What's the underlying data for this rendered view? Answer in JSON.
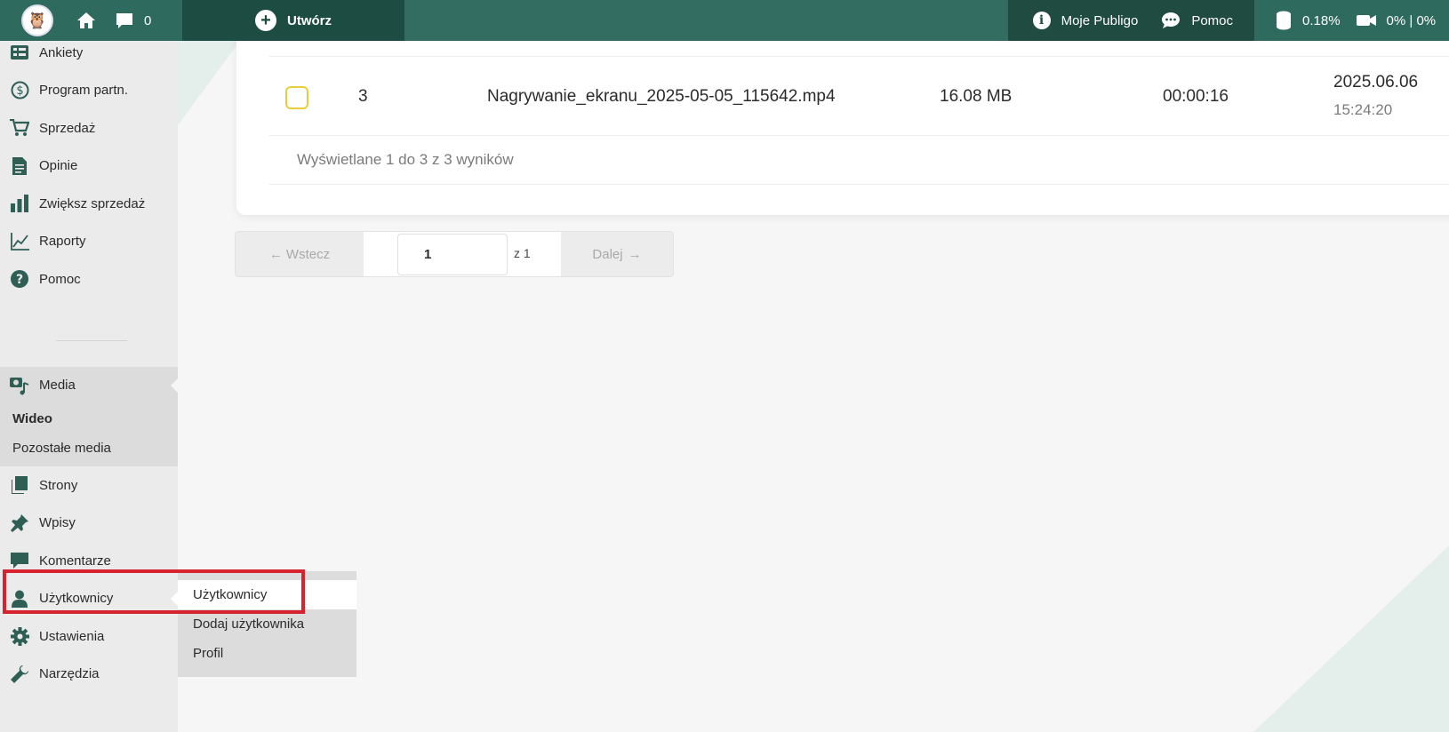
{
  "topbar": {
    "logo_icon": "owl-logo-icon",
    "comments_count": "0",
    "create_label": "Utwórz",
    "my_publigo_label": "Moje Publigo",
    "help_label": "Pomoc",
    "storage_usage": "0.18%",
    "video_usage": "0% | 0%"
  },
  "sidebar": {
    "items_top": [
      {
        "label": "Ankiety",
        "icon": "survey-icon"
      },
      {
        "label": "Program partn.",
        "icon": "dollar-icon"
      },
      {
        "label": "Sprzedaż",
        "icon": "cart-icon"
      },
      {
        "label": "Opinie",
        "icon": "document-icon"
      },
      {
        "label": "Zwiększ sprzedaż",
        "icon": "bar-chart-icon"
      },
      {
        "label": "Raporty",
        "icon": "line-chart-icon"
      },
      {
        "label": "Pomoc",
        "icon": "help-icon"
      }
    ],
    "media": {
      "label": "Media",
      "sub": [
        "Wideo",
        "Pozostałe media"
      ]
    },
    "items_bottom": [
      {
        "label": "Strony",
        "icon": "pages-icon"
      },
      {
        "label": "Wpisy",
        "icon": "pin-icon"
      },
      {
        "label": "Komentarze",
        "icon": "comment-icon"
      },
      {
        "label": "Użytkownicy",
        "icon": "user-icon"
      },
      {
        "label": "Ustawienia",
        "icon": "gear-icon"
      },
      {
        "label": "Narzędzia",
        "icon": "wrench-icon"
      }
    ]
  },
  "flyout": {
    "items": [
      "Użytkownicy",
      "Dodaj użytkownika",
      "Profil"
    ]
  },
  "table": {
    "row": {
      "number": "3",
      "filename": "Nagrywanie_ekranu_2025-05-05_115642.mp4",
      "size": "16.08 MB",
      "duration": "00:00:16",
      "date": "2025.06.06",
      "time": "15:24:20"
    },
    "summary": "Wyświetlane 1 do 3 z 3 wyników"
  },
  "pager": {
    "prev_label": "Wstecz",
    "page_value": "1",
    "of_label": "z 1",
    "next_label": "Dalej"
  },
  "colors": {
    "topbar": "#2f6a5e",
    "topbar_dark": "#1d4d42",
    "highlight": "#d7232e",
    "checkbox_border": "#e6cf3a"
  }
}
